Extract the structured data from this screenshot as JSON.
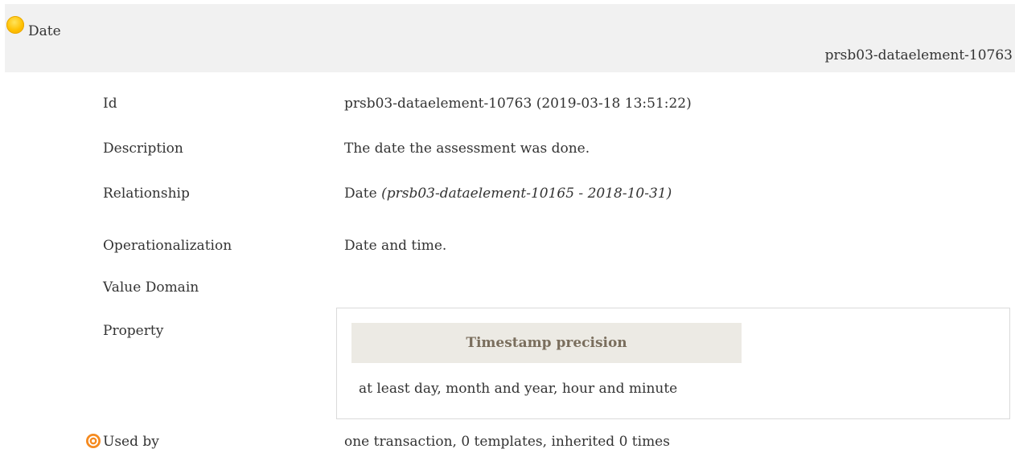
{
  "header": {
    "title": "Date",
    "identifier": "prsb03-dataelement-10763",
    "status_color": "#ffc000"
  },
  "rows": {
    "id": {
      "label": "Id",
      "value": "prsb03-dataelement-10763 (2019-03-18 13:51:22)"
    },
    "description": {
      "label": "Description",
      "value": "The date the assessment was done."
    },
    "relationship": {
      "label": "Relationship",
      "value": "Date",
      "ref": "(prsb03-dataelement-10165 - 2018-10-31)"
    },
    "operationalization": {
      "label": "Operationalization",
      "value": "Date and time."
    },
    "value_domain": {
      "label": "Value Domain"
    },
    "property": {
      "label": "Property",
      "name": "Timestamp precision",
      "value": "at least day, month and year, hour and minute"
    },
    "used_by": {
      "label": "Used by",
      "value": "one transaction, 0 templates, inherited 0 times",
      "icon": "target-icon"
    }
  }
}
